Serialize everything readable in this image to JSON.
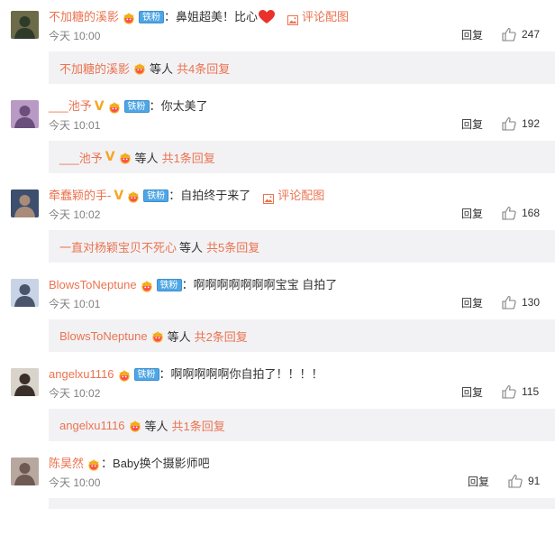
{
  "comments": [
    {
      "username": "不加糖的溪影",
      "badges": [
        "crown",
        "tiefen"
      ],
      "text": "鼻姐超美！比心",
      "heart": true,
      "pic_link": "评论配图",
      "time": "今天 10:00",
      "reply_label": "回复",
      "likes": "247",
      "sub": {
        "username": "不加糖的溪影",
        "badges": [
          "crown"
        ],
        "others": "等人",
        "total": "共4条回复"
      },
      "avatar_colors": [
        "#6b6b4a",
        "#2f3b2a"
      ]
    },
    {
      "username": "___池予",
      "badges": [
        "v",
        "crown",
        "tiefen"
      ],
      "text": "你太美了",
      "heart": false,
      "pic_link": "",
      "time": "今天 10:01",
      "reply_label": "回复",
      "likes": "192",
      "sub": {
        "username": "___池予",
        "badges": [
          "v",
          "crown"
        ],
        "others": "等人",
        "total": "共1条回复"
      },
      "avatar_colors": [
        "#b99ac4",
        "#6a4f7c"
      ]
    },
    {
      "username": "牵蠢颖的手-",
      "badges": [
        "v",
        "crown",
        "tiefen"
      ],
      "text": "自拍终于来了",
      "heart": false,
      "pic_link": "评论配图",
      "time": "今天 10:02",
      "reply_label": "回复",
      "likes": "168",
      "sub": {
        "username": "一直对杨颖宝贝不死心",
        "badges": [],
        "others": "等人",
        "total": "共5条回复"
      },
      "avatar_colors": [
        "#3c4f6e",
        "#a98b79"
      ]
    },
    {
      "username": "BlowsToNeptune",
      "badges": [
        "crown",
        "tiefen"
      ],
      "text": "啊啊啊啊啊啊啊宝宝 自拍了",
      "heart": false,
      "pic_link": "",
      "time": "今天 10:01",
      "reply_label": "回复",
      "likes": "130",
      "sub": {
        "username": "BlowsToNeptune",
        "badges": [
          "crown"
        ],
        "others": "等人",
        "total": "共2条回复"
      },
      "avatar_colors": [
        "#c9d3e6",
        "#4a556b"
      ]
    },
    {
      "username": "angelxu1116",
      "badges": [
        "crown",
        "tiefen"
      ],
      "text": "啊啊啊啊啊你自拍了！！！！",
      "heart": false,
      "pic_link": "",
      "time": "今天 10:02",
      "reply_label": "回复",
      "likes": "115",
      "sub": {
        "username": "angelxu1116",
        "badges": [
          "crown"
        ],
        "others": "等人",
        "total": "共1条回复"
      },
      "avatar_colors": [
        "#d8d3cb",
        "#3a2f2a"
      ]
    },
    {
      "username": "陈昊然",
      "badges": [
        "crown"
      ],
      "text": "Baby换个摄影师吧",
      "heart": false,
      "pic_link": "",
      "time": "今天 10:00",
      "reply_label": "回复",
      "likes": "91",
      "sub": null,
      "avatar_colors": [
        "#b7a89f",
        "#6e5a52"
      ]
    }
  ],
  "colors": {
    "username": "#eb7350",
    "tiefen_badge": "#4fa6e5",
    "sub_bg": "#f2f2f5",
    "vip_v": "#f5a623",
    "heart": "#e8322b"
  },
  "labels": {
    "tiefen": "铁粉",
    "colon": "："
  }
}
